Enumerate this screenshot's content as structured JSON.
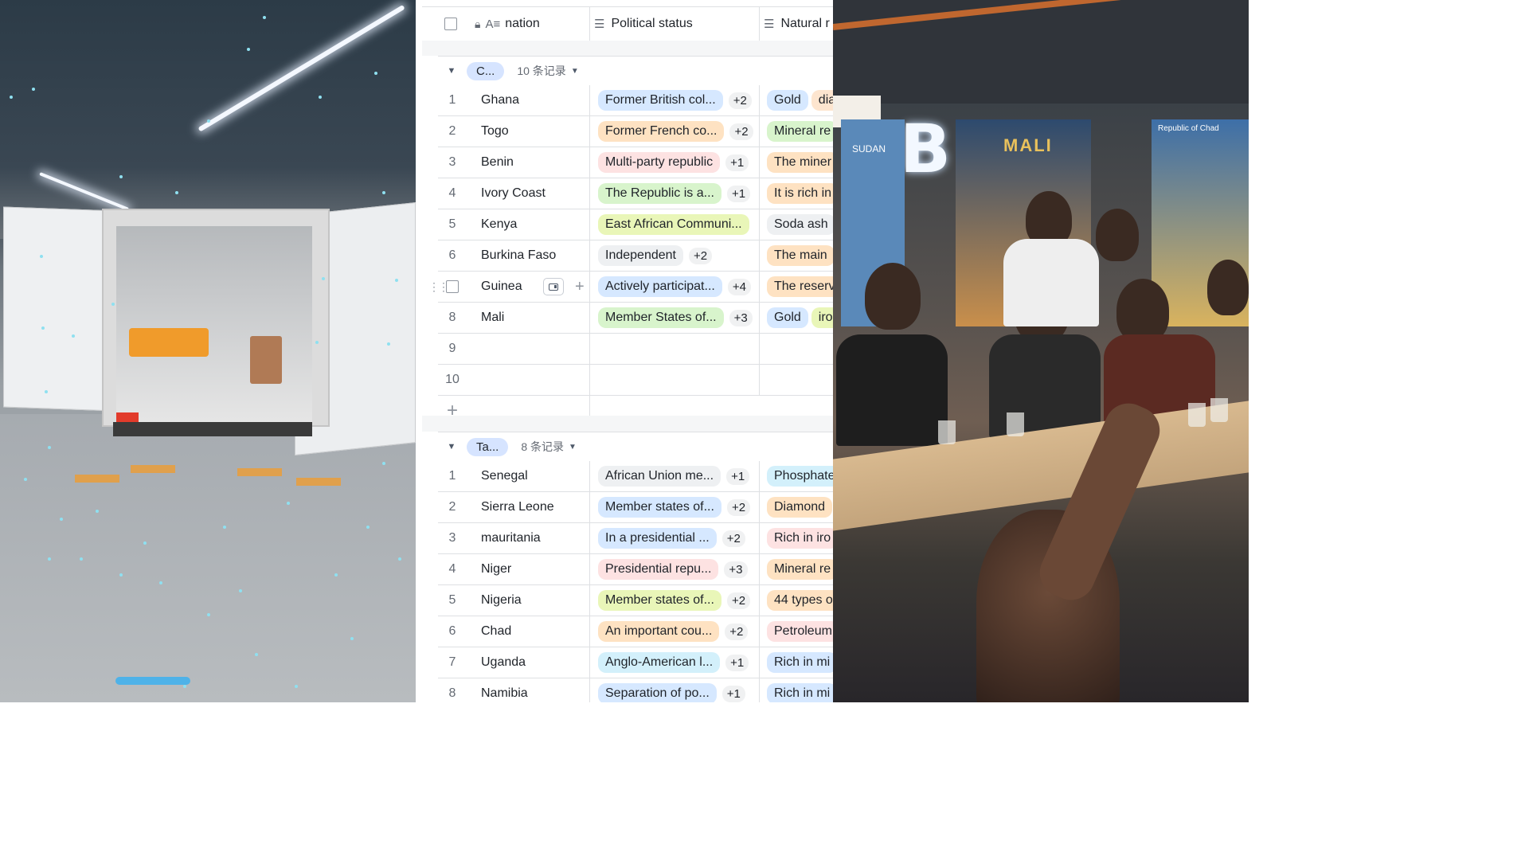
{
  "table": {
    "header": {
      "nation": "nation",
      "political_status": "Political status",
      "natural": "Natural r"
    },
    "icons": {
      "lock": "lock-icon",
      "text_type": "text-type-icon",
      "list_type": "multi-select-icon"
    },
    "groups": [
      {
        "label": "C...",
        "count": "10 条记录",
        "rows": [
          {
            "num": "1",
            "nation": "Ghana",
            "pol": "Former British col...",
            "pol_color": "c-blue",
            "pol_more": "+2",
            "nat": [
              "Gold",
              "dia"
            ],
            "nat_colors": [
              "c-blue",
              "c-peach"
            ]
          },
          {
            "num": "2",
            "nation": "Togo",
            "pol": "Former French co...",
            "pol_color": "c-orange",
            "pol_more": "+2",
            "nat": [
              "Mineral re"
            ],
            "nat_colors": [
              "c-green"
            ]
          },
          {
            "num": "3",
            "nation": "Benin",
            "pol": "Multi-party republic",
            "pol_color": "c-pink",
            "pol_more": "+1",
            "nat": [
              "The miner"
            ],
            "nat_colors": [
              "c-orange"
            ]
          },
          {
            "num": "4",
            "nation": "Ivory Coast",
            "pol": "The Republic is a...",
            "pol_color": "c-green",
            "pol_more": "+1",
            "nat": [
              "It is rich in"
            ],
            "nat_colors": [
              "c-orange"
            ]
          },
          {
            "num": "5",
            "nation": "Kenya",
            "pol": "East African Communi...",
            "pol_color": "c-lime",
            "pol_more": "",
            "nat": [
              "Soda ash"
            ],
            "nat_colors": [
              "c-gray"
            ]
          },
          {
            "num": "6",
            "nation": "Burkina Faso",
            "pol": "Independent",
            "pol_color": "c-gray",
            "pol_more": "+2",
            "nat": [
              "The main"
            ],
            "nat_colors": [
              "c-orange"
            ]
          },
          {
            "num": "7",
            "nation": "Guinea",
            "pol": "Actively participat...",
            "pol_color": "c-blue",
            "pol_more": "+4",
            "nat": [
              "The reserv"
            ],
            "nat_colors": [
              "c-orange"
            ]
          },
          {
            "num": "8",
            "nation": "Mali",
            "pol": "Member States of...",
            "pol_color": "c-green",
            "pol_more": "+3",
            "nat": [
              "Gold",
              "iro"
            ],
            "nat_colors": [
              "c-blue",
              "c-lime"
            ]
          },
          {
            "num": "9",
            "nation": "",
            "pol": "",
            "pol_color": "",
            "pol_more": "",
            "nat": [],
            "nat_colors": []
          },
          {
            "num": "10",
            "nation": "",
            "pol": "",
            "pol_color": "",
            "pol_more": "",
            "nat": [],
            "nat_colors": []
          }
        ]
      },
      {
        "label": "Ta...",
        "count": "8 条记录",
        "rows": [
          {
            "num": "1",
            "nation": "Senegal",
            "pol": "African Union me...",
            "pol_color": "c-gray",
            "pol_more": "+1",
            "nat": [
              "Phosphate"
            ],
            "nat_colors": [
              "c-cyan"
            ]
          },
          {
            "num": "2",
            "nation": "Sierra Leone",
            "pol": "Member states of...",
            "pol_color": "c-blue",
            "pol_more": "+2",
            "nat": [
              "Diamond"
            ],
            "nat_colors": [
              "c-orange"
            ]
          },
          {
            "num": "3",
            "nation": "mauritania",
            "pol": "In a presidential ...",
            "pol_color": "c-blue",
            "pol_more": "+2",
            "nat": [
              "Rich in iro"
            ],
            "nat_colors": [
              "c-pink"
            ]
          },
          {
            "num": "4",
            "nation": "Niger",
            "pol": "Presidential repu...",
            "pol_color": "c-pink",
            "pol_more": "+3",
            "nat": [
              "Mineral re"
            ],
            "nat_colors": [
              "c-orange"
            ]
          },
          {
            "num": "5",
            "nation": "Nigeria",
            "pol": "Member states of...",
            "pol_color": "c-lime",
            "pol_more": "+2",
            "nat": [
              "44 types o"
            ],
            "nat_colors": [
              "c-orange"
            ]
          },
          {
            "num": "6",
            "nation": "Chad",
            "pol": "An important cou...",
            "pol_color": "c-orange",
            "pol_more": "+2",
            "nat": [
              "Petroleum"
            ],
            "nat_colors": [
              "c-pink"
            ]
          },
          {
            "num": "7",
            "nation": "Uganda",
            "pol": "Anglo-American l...",
            "pol_color": "c-cyan",
            "pol_more": "+1",
            "nat": [
              "Rich in mi"
            ],
            "nat_colors": [
              "c-blue"
            ]
          },
          {
            "num": "8",
            "nation": "Namibia",
            "pol": "Separation of po...",
            "pol_color": "c-blue",
            "pol_more": "+1",
            "nat": [
              "Rich in mi"
            ],
            "nat_colors": [
              "c-blue"
            ]
          }
        ]
      }
    ],
    "hovered_row": "Guinea"
  },
  "photo": {
    "sign_letter": "B",
    "banner_mali": "MALI",
    "banner_sudan": "SUDAN",
    "banner_chad": "Republic of Chad"
  }
}
